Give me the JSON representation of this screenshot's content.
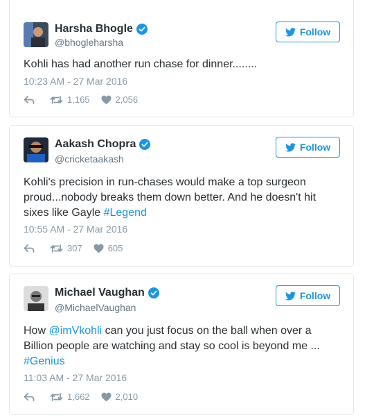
{
  "accent_color": "#1b95e0",
  "tweets": [
    {
      "name": "Harsha Bhogle",
      "handle": "@bhogleharsha",
      "follow_label": "Follow",
      "text": "Kohli has had another run chase for dinner........",
      "timestamp": "10:23 AM - 27 Mar 2016",
      "retweets": "1,165",
      "likes": "2,056"
    },
    {
      "name": "Aakash Chopra",
      "handle": "@cricketaakash",
      "follow_label": "Follow",
      "text_parts": [
        "Kohli's precision in run-chases would make a top surgeon proud...nobody breaks them down better. And he doesn't hit sixes like Gayle ",
        "#Legend"
      ],
      "timestamp": "10:55 AM - 27 Mar 2016",
      "retweets": "307",
      "likes": "605"
    },
    {
      "name": "Michael Vaughan",
      "handle": "@MichaelVaughan",
      "follow_label": "Follow",
      "text_parts": [
        "How ",
        "@imVkohli",
        " can you just focus on the ball when over a Billion people are watching and stay so cool is beyond me ...",
        "#Genius"
      ],
      "timestamp": "11:03 AM - 27 Mar 2016",
      "retweets": "1,662",
      "likes": "2,010"
    }
  ]
}
